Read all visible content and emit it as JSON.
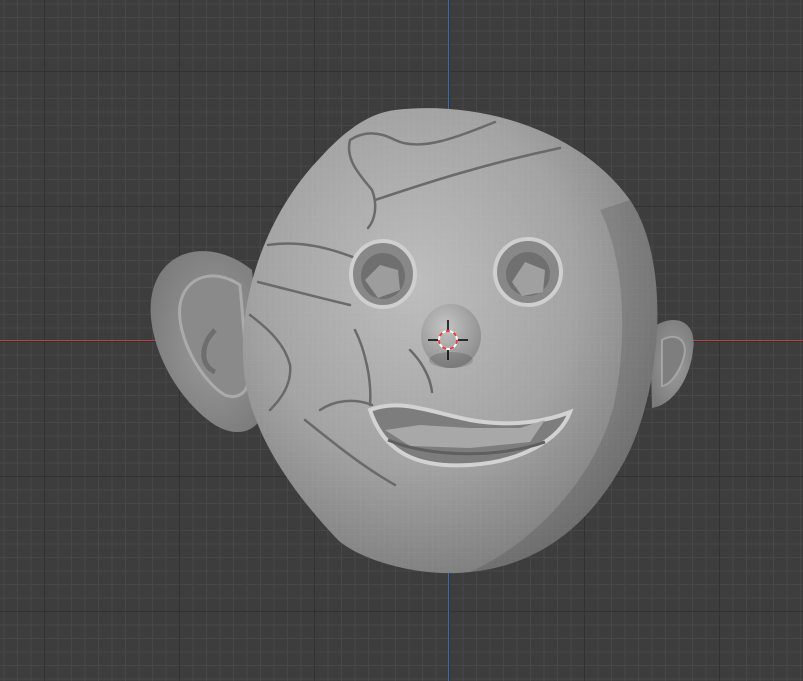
{
  "viewport": {
    "background_color": "#3d3d3d",
    "grid_color": "#474747",
    "x_axis_color": "#b5404a",
    "y_axis_color": "#3d6bb0"
  },
  "model": {
    "icon": "sculpted-head-mesh",
    "surface_color": "#9a9a9a"
  },
  "cursor": {
    "icon": "3d-cursor-icon",
    "ring_colors": [
      "#e04040",
      "#ffffff"
    ]
  }
}
